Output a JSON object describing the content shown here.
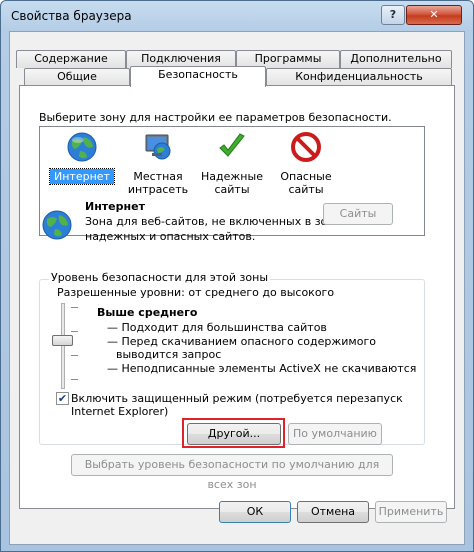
{
  "window": {
    "title": "Свойства браузера",
    "help_label": "?",
    "close_label": "✕"
  },
  "tabs": {
    "row1": [
      "Содержание",
      "Подключения",
      "Программы",
      "Дополнительно"
    ],
    "row2": [
      "Общие",
      "Безопасность",
      "Конфиденциальность"
    ]
  },
  "zones": {
    "prompt": "Выберите зону для настройки ее параметров безопасности.",
    "items": [
      {
        "line1": "Интернет",
        "line2": "",
        "icon": "globe-icon"
      },
      {
        "line1": "Местная",
        "line2": "интрасеть",
        "icon": "intranet-icon"
      },
      {
        "line1": "Надежные",
        "line2": "сайты",
        "icon": "checkmark-icon"
      },
      {
        "line1": "Опасные",
        "line2": "сайты",
        "icon": "restricted-icon"
      }
    ]
  },
  "zone_info": {
    "title": "Интернет",
    "desc_line1": "Зона для веб-сайтов, не включенных в зоны",
    "desc_line2": "надежных и опасных сайтов.",
    "sites_button": "Сайты"
  },
  "security_level": {
    "group_title": "Уровень безопасности для этой зоны",
    "allowed": "Разрешенные уровни: от среднего до высокого",
    "level_name": "Выше среднего",
    "bullets": [
      "— Подходит для большинства сайтов",
      "— Перед скачиванием опасного содержимого",
      "выводится запрос",
      "— Неподписанные элементы ActiveX не скачиваются"
    ],
    "protected_mode_line1": "Включить защищенный режим (потребуется перезапуск",
    "protected_mode_line2": "Internet Explorer)",
    "protected_mode_checked": true,
    "custom_button": "Другой...",
    "default_button": "По умолчанию",
    "reset_all_button": "Выбрать уровень безопасности по умолчанию для всех зон"
  },
  "footer": {
    "ok": "ОК",
    "cancel": "Отмена",
    "apply": "Применить"
  },
  "colors": {
    "selection": "#3399ff",
    "highlight_border": "#e0232a",
    "title_bg": "#b4cde6"
  }
}
